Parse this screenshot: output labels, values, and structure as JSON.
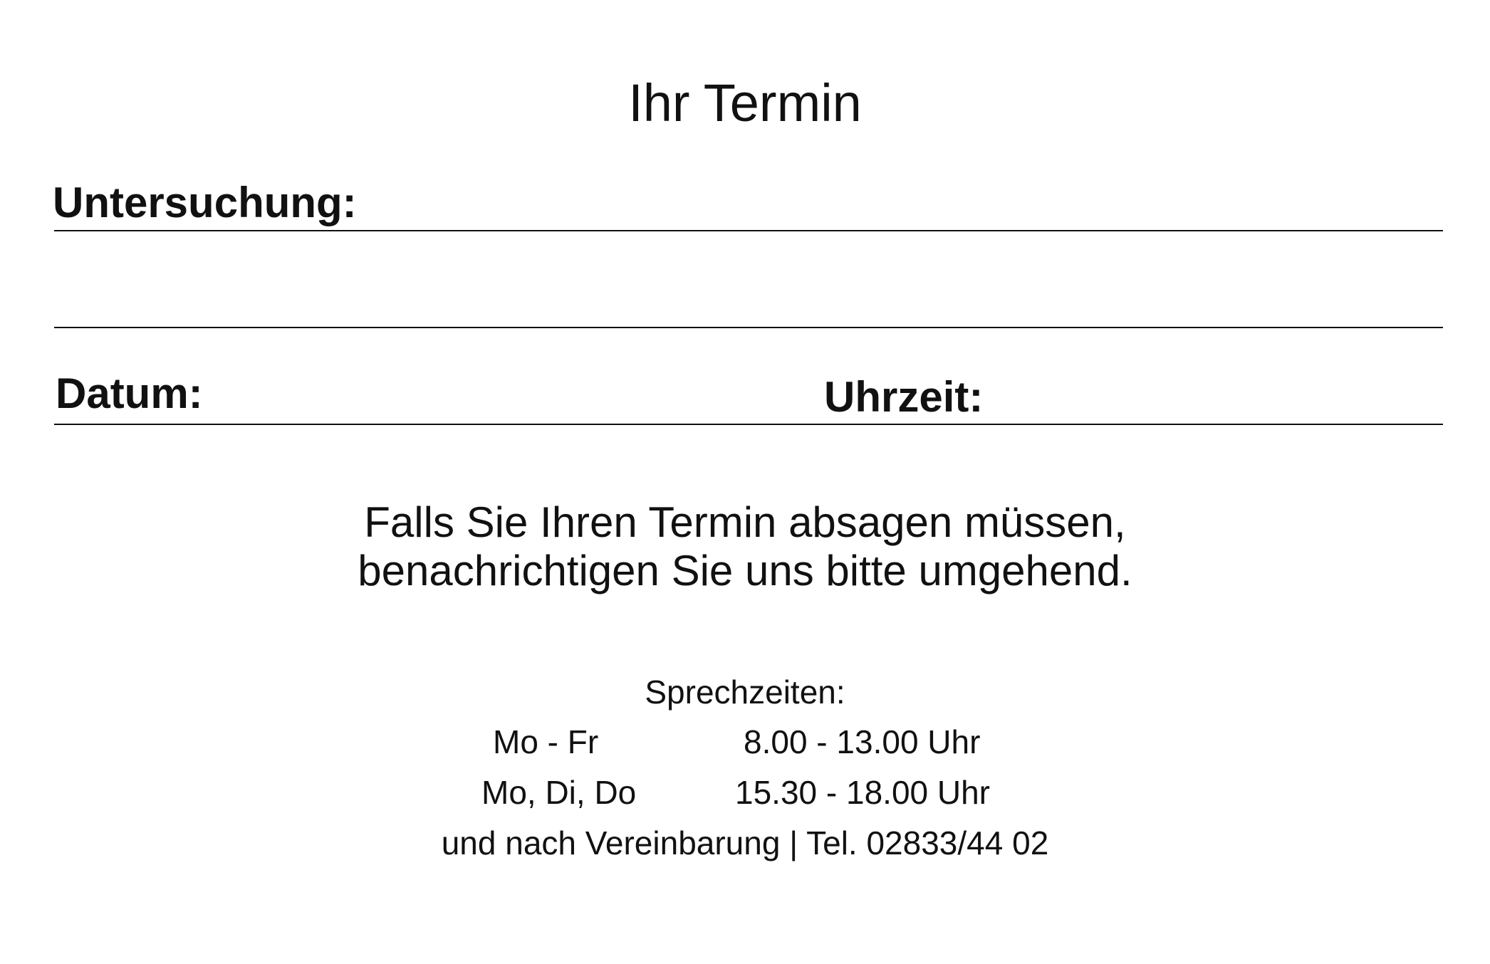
{
  "card": {
    "title": "Ihr Termin",
    "fields": {
      "examination_label": "Untersuchung:",
      "date_label": "Datum:",
      "time_label": "Uhrzeit:"
    },
    "notice": {
      "line1": "Falls Sie Ihren Termin absagen müssen,",
      "line2": "benachrichtigen Sie uns bitte umgehend."
    },
    "office_hours": {
      "heading": "Sprechzeiten:",
      "rows": [
        {
          "days": "Mo - Fr",
          "time": "8.00 - 13.00 Uhr"
        },
        {
          "days": "Mo, Di, Do",
          "time": "15.30 - 18.00 Uhr"
        }
      ],
      "footer": "und nach Vereinbarung | Tel. 02833/44 02"
    }
  }
}
